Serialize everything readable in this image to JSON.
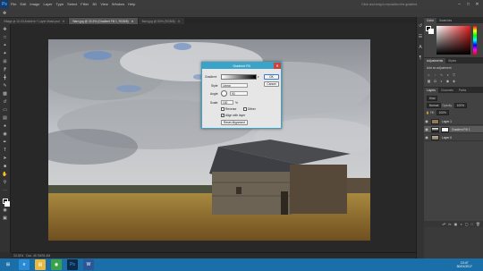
{
  "menubar": {
    "logo": "Ps",
    "items": [
      "File",
      "Edit",
      "Image",
      "Layer",
      "Type",
      "Select",
      "Filter",
      "3D",
      "View",
      "Window",
      "Help"
    ],
    "hint": "Click and drag to reposition the gradient."
  },
  "tabs": [
    {
      "label": "Village je 10-03 Ambient + Layer Mask.psd",
      "active": false
    },
    {
      "label": "Barn.jpg @ 33.3% (Gradient Fill 1, RGB/8)",
      "active": true
    },
    {
      "label": "Barn.jpg @ 50% (RGB/8)",
      "active": false
    }
  ],
  "dialog": {
    "title": "Gradient Fill",
    "labels": {
      "gradient": "Gradient:",
      "style": "Style:",
      "angle": "Angle:",
      "scale": "Scale:"
    },
    "style_value": "Linear",
    "angle_value": "90",
    "scale_value": "100",
    "scale_unit": "%",
    "reverse": "Reverse",
    "dither": "Dither",
    "align": "Align with layer",
    "reset": "Reset Alignment",
    "ok": "OK",
    "cancel": "Cancel"
  },
  "panels": {
    "color_tabs": [
      "Color",
      "Swatches"
    ],
    "adjustments_tabs": [
      "Adjustments",
      "Styles"
    ],
    "adjustments_title": "Add an adjustment",
    "layers_tabs": [
      "Layers",
      "Channels",
      "Paths"
    ],
    "layers": [
      {
        "name": "Layer 1",
        "selected": false
      },
      {
        "name": "Gradient Fill 1",
        "selected": true
      },
      {
        "name": "Layer 0",
        "selected": false
      }
    ],
    "kind_label": "Kind",
    "blend_label": "Normal",
    "opacity_label": "Opacity:",
    "opacity_value": "100%",
    "fill_label": "Fill:",
    "fill_value": "100%"
  },
  "status": {
    "zoom": "33.33%",
    "doc_size": "Doc: 45.7M/91.4M"
  },
  "taskbar": {
    "time": "13:47",
    "date": "30/01/2017",
    "lang": "ENG"
  },
  "colors": {
    "accent": "#3aa3c8",
    "taskbar": "#1a6fa8"
  }
}
